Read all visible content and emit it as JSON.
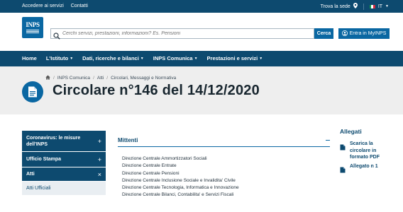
{
  "topbar": {
    "accedi": "Accedere ai servizi",
    "contatti": "Contatti",
    "trova_sede": "Trova la sede",
    "lang": "IT",
    "flag_colors": [
      "#0f9a48",
      "#ffffff",
      "#d3283a"
    ]
  },
  "header": {
    "logo_text": "INPS",
    "search_placeholder": "Cerchi servizi, prestazioni, informazioni? Es. Pensioni",
    "search_button": "Cerca",
    "login_button": "Entra in MyINPS"
  },
  "nav": {
    "items": [
      {
        "label": "Home",
        "chevron": false
      },
      {
        "label": "L'Istituto",
        "chevron": true
      },
      {
        "label": "Dati, ricerche e bilanci",
        "chevron": true
      },
      {
        "label": "INPS Comunica",
        "chevron": true
      },
      {
        "label": "Prestazioni e servizi",
        "chevron": true
      }
    ]
  },
  "titlebar": {
    "breadcrumb": [
      "INPS Comunica",
      "Atti",
      "Circolari, Messaggi e Normativa"
    ],
    "title": "Circolare n°146 del 14/12/2020"
  },
  "sidebar": {
    "items": [
      {
        "label": "Coronavirus: le misure dell'INPS",
        "control": "+",
        "style": "dark"
      },
      {
        "label": "Ufficio Stampa",
        "control": "+",
        "style": "dark"
      },
      {
        "label": "Atti",
        "control": "×",
        "style": "dark"
      },
      {
        "label": "Atti Ufficiali",
        "control": "",
        "style": "light"
      }
    ]
  },
  "mittenti": {
    "title": "Mittenti",
    "items": [
      "Direzione Centrale Ammortizzatori Sociali",
      "Direzione Centrale Entrate",
      "Direzione Centrale Pensioni",
      "Direzione Centrale Inclusione Sociale e Invalidita' Civile",
      "Direzione Centrale Tecnologia, Informatica e Innovazione",
      "Direzione Centrale Bilanci, Contabilita' e Servizi Fiscali"
    ]
  },
  "allegati": {
    "title": "Allegati",
    "items": [
      {
        "label": "Scarica la circolare in formato PDF"
      },
      {
        "label": "Allegato n 1"
      }
    ]
  },
  "colors": {
    "primary": "#0a67a2",
    "dark": "#0d4a6f",
    "title_bg": "#eeeeee"
  }
}
